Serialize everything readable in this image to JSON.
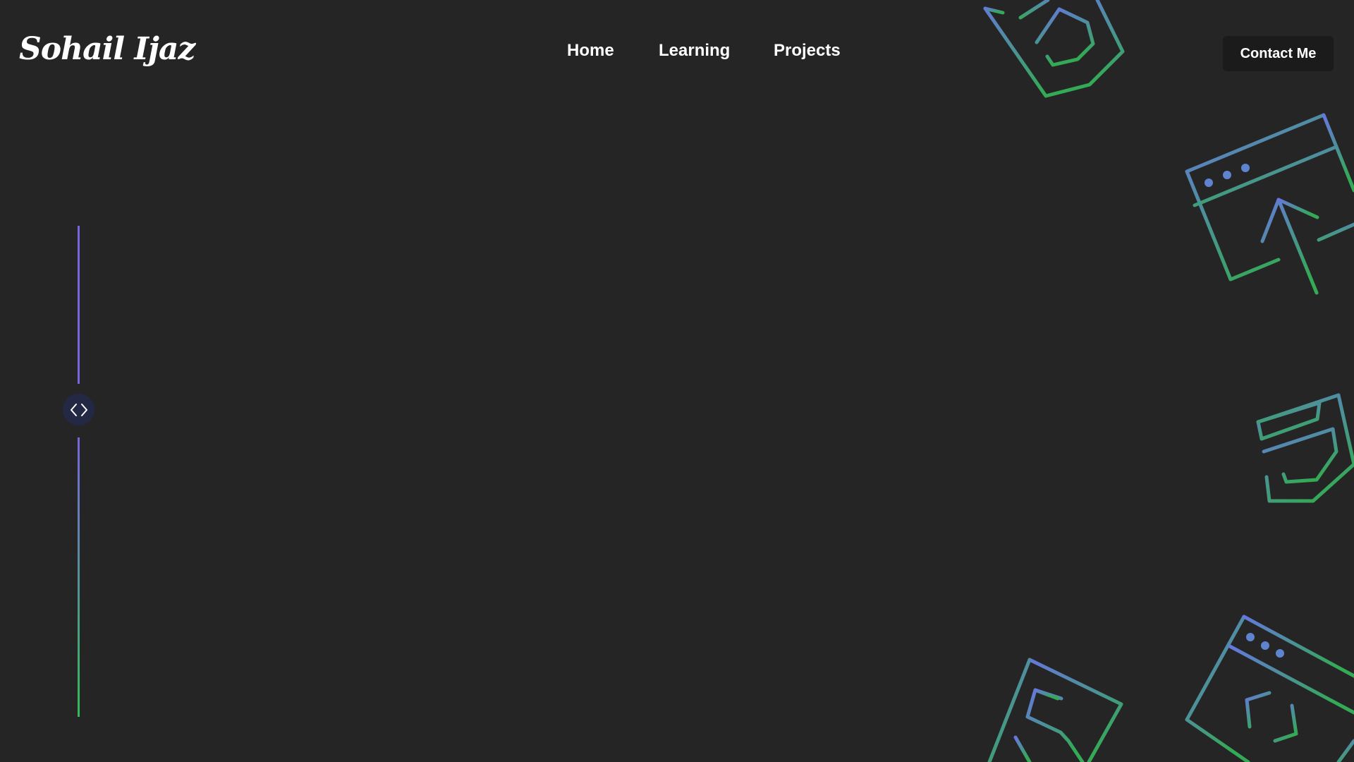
{
  "header": {
    "logo_text": "Sohail Ijaz",
    "nav": [
      {
        "label": "Home"
      },
      {
        "label": "Learning"
      },
      {
        "label": "Projects"
      }
    ],
    "contact_label": "Contact Me"
  },
  "timeline": {
    "node_icon": "code-brackets-icon"
  },
  "decorations": {
    "icons": [
      "css3-icon",
      "browser-cursor-icon",
      "css3-icon",
      "html5-icon",
      "browser-code-icon"
    ],
    "gradient_start": "#6677dd",
    "gradient_end": "#33aa55"
  },
  "colors": {
    "background": "#252525",
    "button_bg": "#1b1b1b",
    "timeline_top": "#7766dd",
    "timeline_bottom": "#33bb55",
    "node_bg": "#232844"
  }
}
